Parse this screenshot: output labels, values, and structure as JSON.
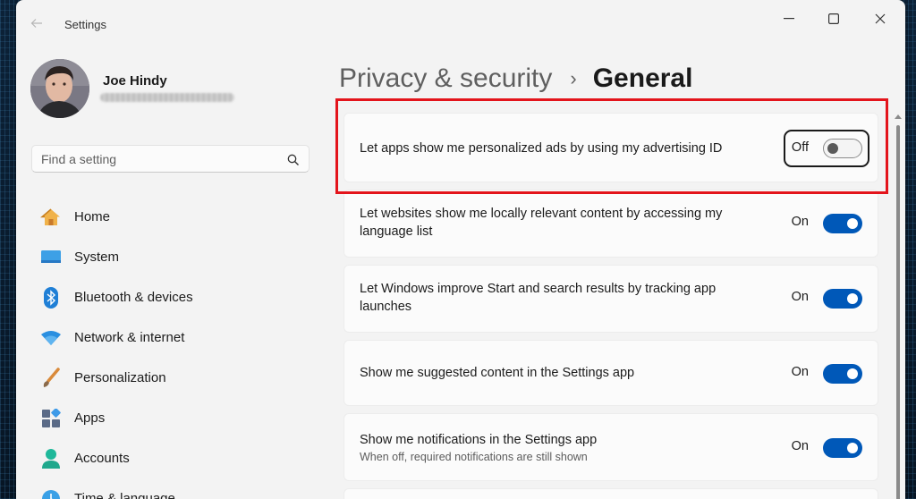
{
  "window": {
    "app_title": "Settings",
    "controls": [
      "minimize-icon",
      "maximize-icon",
      "close-icon"
    ]
  },
  "profile": {
    "name": "Joe Hindy"
  },
  "search": {
    "placeholder": "Find a setting",
    "icon": "search-icon"
  },
  "sidebar": {
    "items": [
      {
        "label": "Home",
        "icon": "home-icon"
      },
      {
        "label": "System",
        "icon": "monitor-icon"
      },
      {
        "label": "Bluetooth & devices",
        "icon": "bluetooth-icon"
      },
      {
        "label": "Network & internet",
        "icon": "wifi-icon"
      },
      {
        "label": "Personalization",
        "icon": "paintbrush-icon"
      },
      {
        "label": "Apps",
        "icon": "apps-icon"
      },
      {
        "label": "Accounts",
        "icon": "person-icon"
      },
      {
        "label": "Time & language",
        "icon": "clock-globe-icon"
      }
    ]
  },
  "breadcrumb": {
    "parent": "Privacy & security",
    "separator": "›",
    "current": "General"
  },
  "settings": [
    {
      "label": "Let apps show me personalized ads by using my advertising ID",
      "state": "Off",
      "enabled": false
    },
    {
      "label": "Let websites show me locally relevant content by accessing my language list",
      "state": "On",
      "enabled": true
    },
    {
      "label": "Let Windows improve Start and search results by tracking app launches",
      "state": "On",
      "enabled": true
    },
    {
      "label": "Show me suggested content in the Settings app",
      "state": "On",
      "enabled": true
    },
    {
      "label": "Show me notifications in the Settings app",
      "sub": "When off, required notifications are still shown",
      "state": "On",
      "enabled": true
    }
  ],
  "colors": {
    "accent": "#0058b8",
    "highlight": "#e3141b"
  }
}
